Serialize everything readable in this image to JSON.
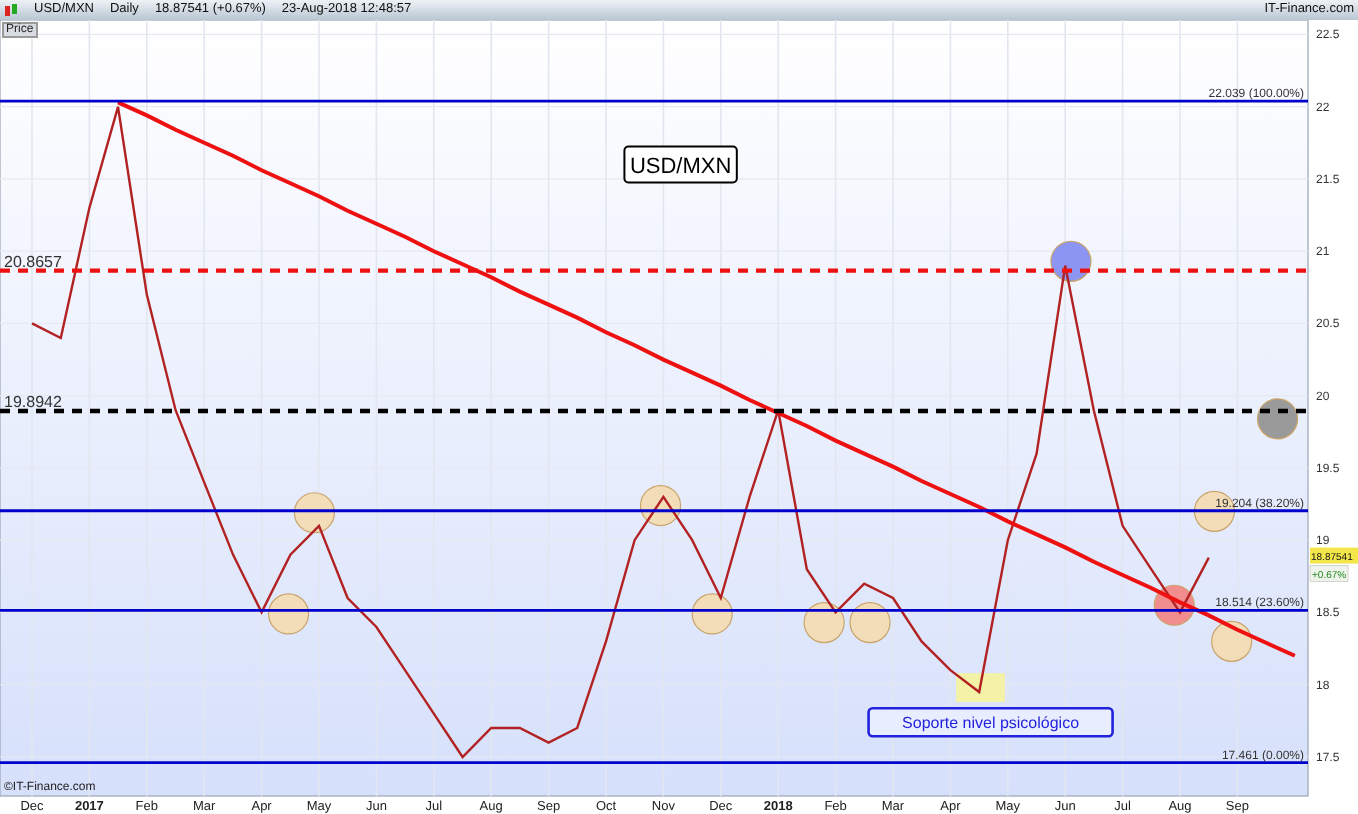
{
  "header": {
    "symbol": "USD/MXN",
    "period": "Daily",
    "quote": "18.87541 (+0.67%)",
    "timestamp": "23-Aug-2018 12:48:57",
    "brand": "IT-Finance.com"
  },
  "axis_label": "Price",
  "price_tag": {
    "value": "18.87541",
    "change": "+0.67%"
  },
  "copyright": "©IT-Finance.com",
  "chart_data": {
    "type": "line",
    "title": "USD/MXN",
    "categories": [
      "Dec",
      null,
      "2017",
      null,
      "Feb",
      null,
      "Mar",
      null,
      "Apr",
      null,
      "May",
      null,
      "Jun",
      null,
      "Jul",
      null,
      "Aug",
      null,
      "Sep",
      null,
      "Oct",
      null,
      "Nov",
      null,
      "Dec",
      null,
      "2018",
      null,
      "Feb",
      null,
      "Mar",
      null,
      "Apr",
      null,
      "May",
      null,
      "Jun",
      null,
      "Jul",
      null,
      "Aug",
      null,
      "Sep",
      null,
      null
    ],
    "series": [
      {
        "color": "#b22222",
        "values": [
          20.5,
          20.4,
          21.3,
          22.0,
          20.7,
          19.9,
          19.4,
          18.9,
          18.5,
          18.9,
          19.1,
          18.6,
          18.4,
          18.1,
          17.8,
          17.5,
          17.7,
          17.7,
          17.6,
          17.7,
          18.3,
          19.0,
          19.3,
          19.0,
          18.6,
          19.3,
          19.9,
          18.8,
          18.5,
          18.7,
          18.6,
          18.3,
          18.1,
          17.95,
          19.0,
          19.6,
          20.9,
          19.9,
          19.1,
          18.8,
          18.5,
          18.88,
          null,
          null,
          null
        ]
      },
      {
        "color": "#ee1111",
        "values": [
          null,
          null,
          null,
          22.03,
          21.94,
          21.84,
          21.75,
          21.66,
          21.56,
          21.47,
          21.38,
          21.28,
          21.19,
          21.1,
          21.0,
          20.91,
          20.82,
          20.72,
          20.63,
          20.54,
          20.44,
          20.35,
          20.25,
          20.16,
          20.07,
          19.97,
          19.88,
          19.79,
          19.69,
          19.6,
          19.51,
          19.41,
          19.32,
          19.23,
          19.13,
          19.04,
          18.95,
          18.85,
          18.76,
          18.67,
          18.57,
          18.48,
          18.38,
          18.29,
          18.2
        ]
      }
    ],
    "ylim": [
      17.23,
      22.6
    ],
    "yticks": [
      17.5,
      18,
      18.5,
      19,
      19.5,
      20,
      20.5,
      21,
      21.5,
      22,
      22.5
    ],
    "ref_lines": [
      {
        "axis": "y",
        "value": 22.039,
        "label": "22.039 (100.00%)",
        "color": "#0000cc"
      },
      {
        "axis": "y",
        "value": 20.8657,
        "label": "20.8657",
        "color": "#ee1111"
      },
      {
        "axis": "y",
        "value": 19.8942,
        "label": "19.8942",
        "color": "#000000"
      },
      {
        "axis": "y",
        "value": 19.204,
        "label": "19.204 (38.20%)",
        "color": "#0000cc"
      },
      {
        "axis": "y",
        "value": 18.514,
        "label": "18.514 (23.60%)",
        "color": "#0000cc"
      },
      {
        "axis": "y",
        "value": 17.461,
        "label": "17.461 (0.00%)",
        "color": "#0000cc"
      }
    ],
    "grid": true,
    "annotations": [
      "Soporte nivel psicológico"
    ]
  }
}
